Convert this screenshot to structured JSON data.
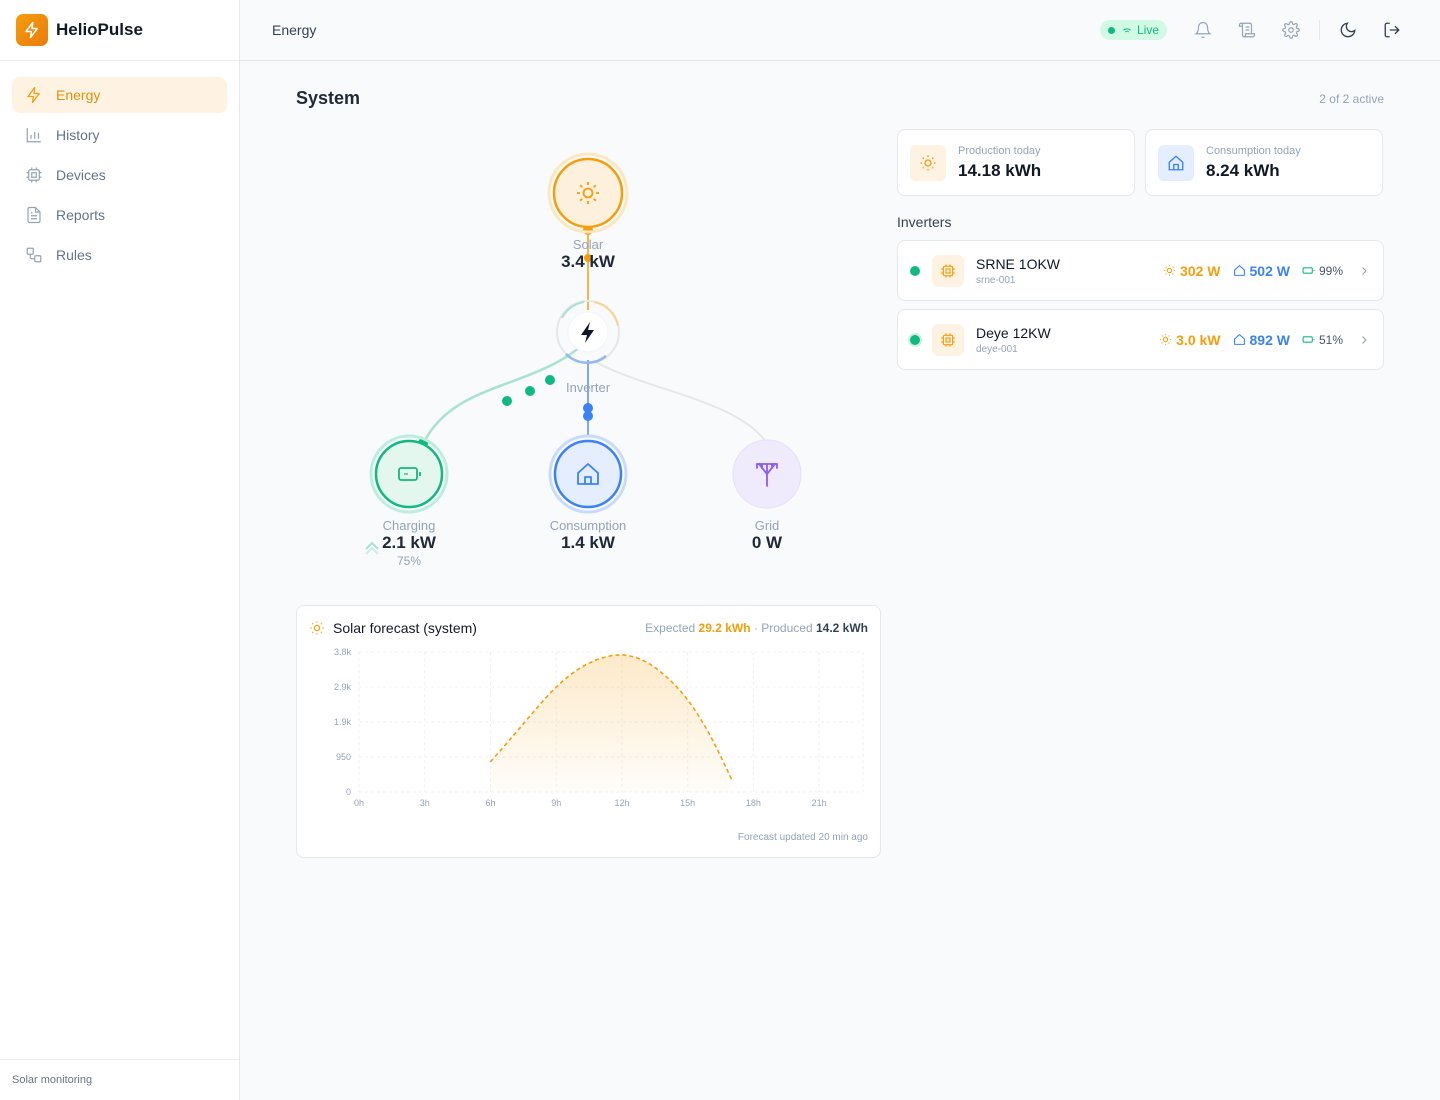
{
  "brand": {
    "name": "HelioPulse"
  },
  "sidebar": {
    "items": [
      {
        "label": "Energy",
        "icon": "lightning-icon",
        "active": true
      },
      {
        "label": "History",
        "icon": "bar-chart-icon",
        "active": false
      },
      {
        "label": "Devices",
        "icon": "cpu-icon",
        "active": false
      },
      {
        "label": "Reports",
        "icon": "document-icon",
        "active": false
      },
      {
        "label": "Rules",
        "icon": "workflow-icon",
        "active": false
      }
    ],
    "footer": "Solar monitoring"
  },
  "header": {
    "title": "Energy",
    "live_label": "Live"
  },
  "system": {
    "title": "System",
    "active_count": "2 of 2 active",
    "solar": {
      "label": "Solar",
      "value": "3.4 kW"
    },
    "inverter": {
      "label": "Inverter"
    },
    "battery": {
      "label": "Charging",
      "value": "2.1 kW",
      "soc": "75%"
    },
    "consumption": {
      "label": "Consumption",
      "value": "1.4 kW"
    },
    "grid": {
      "label": "Grid",
      "value": "0 W"
    }
  },
  "stats": {
    "production": {
      "label": "Production today",
      "value": "14.18 kWh"
    },
    "consumption": {
      "label": "Consumption today",
      "value": "8.24 kWh"
    }
  },
  "inverters": {
    "title": "Inverters",
    "items": [
      {
        "name": "SRNE 1OKW",
        "id": "srne-001",
        "solar": "302 W",
        "load": "502 W",
        "battery": "99%"
      },
      {
        "name": "Deye 12KW",
        "id": "deye-001",
        "solar": "3.0 kW",
        "load": "892 W",
        "battery": "51%"
      }
    ]
  },
  "forecast": {
    "title": "Solar forecast (system)",
    "expected_label": "Expected",
    "expected_value": "29.2 kWh",
    "separator": "·",
    "produced_label": "Produced",
    "produced_value": "14.2 kWh",
    "footer": "Forecast updated 20 min ago"
  },
  "colors": {
    "accent": "#f59e0b",
    "consumption": "#3b82f6",
    "battery": "#10b981",
    "grid": "#8b5cf6"
  },
  "chart_data": {
    "type": "line",
    "x_tick_labels": [
      "0h",
      "3h",
      "6h",
      "9h",
      "12h",
      "15h",
      "18h",
      "21h"
    ],
    "y_tick_labels": [
      "0",
      "950",
      "1.9k",
      "2.9k",
      "3.8k"
    ],
    "xlim": [
      0,
      23
    ],
    "ylim": [
      0,
      3800
    ],
    "grid": true,
    "style": "dashed-area",
    "x": [
      6,
      7,
      8,
      9,
      10,
      11,
      12,
      13,
      14,
      15,
      16,
      17
    ],
    "y": [
      820,
      1500,
      2200,
      2850,
      3330,
      3620,
      3720,
      3560,
      3140,
      2500,
      1560,
      350
    ]
  }
}
